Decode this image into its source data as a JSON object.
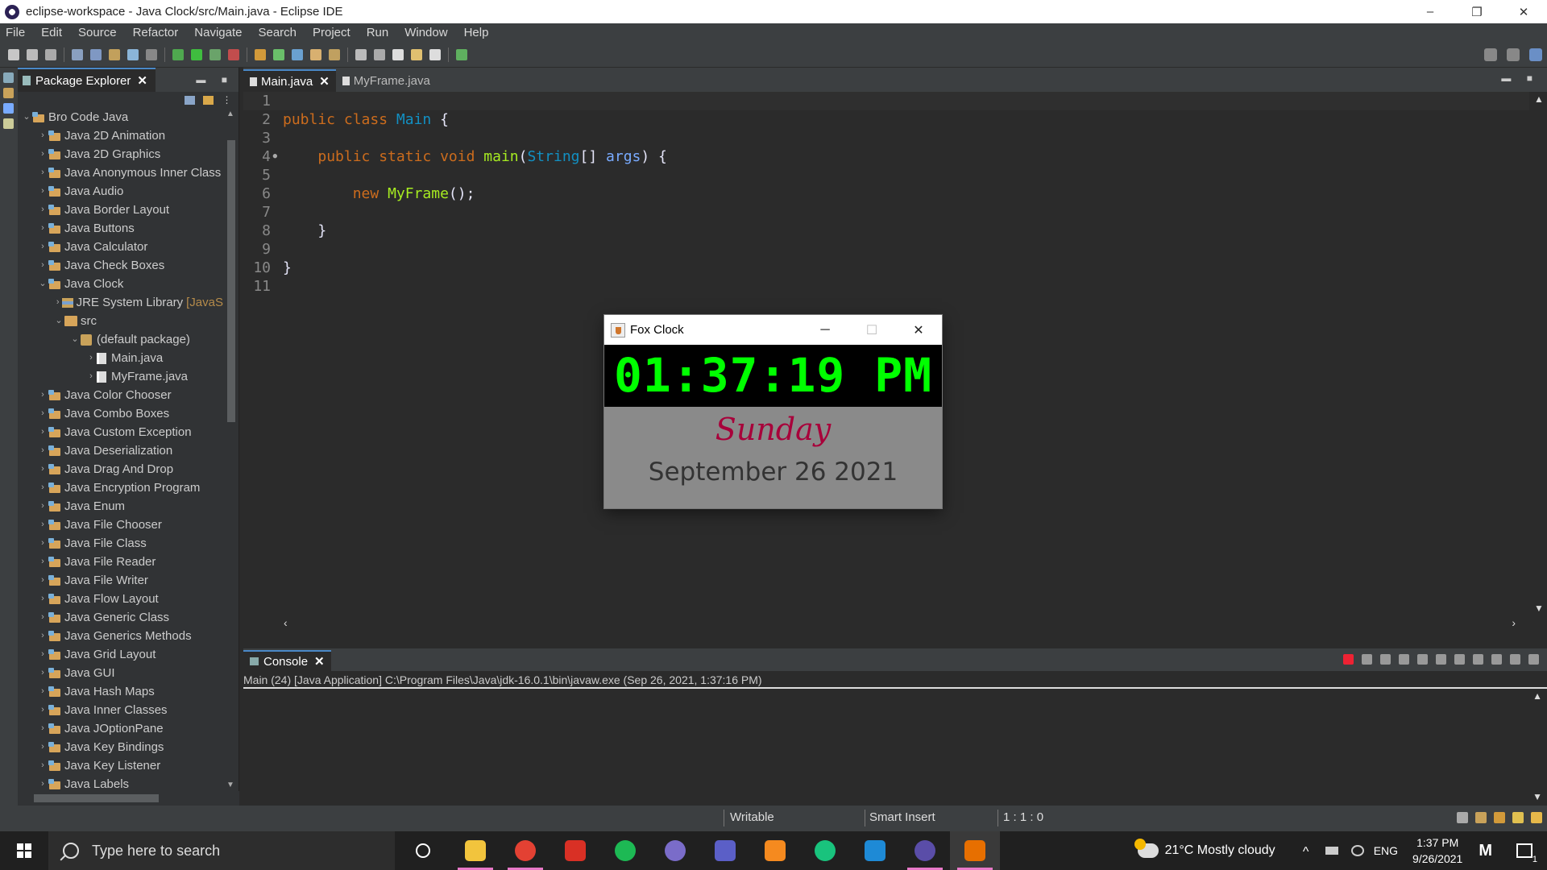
{
  "window": {
    "title": "eclipse-workspace - Java Clock/src/Main.java - Eclipse IDE",
    "minimize": "–",
    "restore": "❐",
    "close": "✕"
  },
  "menu": [
    "File",
    "Edit",
    "Source",
    "Refactor",
    "Navigate",
    "Search",
    "Project",
    "Run",
    "Window",
    "Help"
  ],
  "package_explorer": {
    "tab_label": "Package Explorer",
    "close_label": "✕",
    "view_controls": "▬ ■",
    "tree": [
      {
        "label": "Bro Code Java",
        "depth": 0,
        "expanded": true,
        "icon": "project"
      },
      {
        "label": "Java 2D Animation",
        "depth": 1,
        "expanded": false,
        "icon": "project"
      },
      {
        "label": "Java 2D Graphics",
        "depth": 1,
        "expanded": false,
        "icon": "project"
      },
      {
        "label": "Java Anonymous Inner Class",
        "depth": 1,
        "expanded": false,
        "icon": "project"
      },
      {
        "label": "Java Audio",
        "depth": 1,
        "expanded": false,
        "icon": "project"
      },
      {
        "label": "Java Border Layout",
        "depth": 1,
        "expanded": false,
        "icon": "project"
      },
      {
        "label": "Java Buttons",
        "depth": 1,
        "expanded": false,
        "icon": "project"
      },
      {
        "label": "Java Calculator",
        "depth": 1,
        "expanded": false,
        "icon": "project"
      },
      {
        "label": "Java Check Boxes",
        "depth": 1,
        "expanded": false,
        "icon": "project"
      },
      {
        "label": "Java Clock",
        "depth": 1,
        "expanded": true,
        "icon": "project"
      },
      {
        "label": "JRE System Library",
        "suffix": "[JavaS",
        "depth": 2,
        "expanded": false,
        "icon": "library"
      },
      {
        "label": "src",
        "depth": 2,
        "expanded": true,
        "icon": "source-folder"
      },
      {
        "label": "(default package)",
        "depth": 3,
        "expanded": true,
        "icon": "package"
      },
      {
        "label": "Main.java",
        "depth": 4,
        "expanded": false,
        "icon": "java-file"
      },
      {
        "label": "MyFrame.java",
        "depth": 4,
        "expanded": false,
        "icon": "java-file"
      },
      {
        "label": "Java Color Chooser",
        "depth": 1,
        "expanded": false,
        "icon": "project"
      },
      {
        "label": "Java Combo Boxes",
        "depth": 1,
        "expanded": false,
        "icon": "project"
      },
      {
        "label": "Java Custom Exception",
        "depth": 1,
        "expanded": false,
        "icon": "project"
      },
      {
        "label": "Java Deserialization",
        "depth": 1,
        "expanded": false,
        "icon": "project"
      },
      {
        "label": "Java Drag And Drop",
        "depth": 1,
        "expanded": false,
        "icon": "project"
      },
      {
        "label": "Java Encryption Program",
        "depth": 1,
        "expanded": false,
        "icon": "project"
      },
      {
        "label": "Java Enum",
        "depth": 1,
        "expanded": false,
        "icon": "project"
      },
      {
        "label": "Java File Chooser",
        "depth": 1,
        "expanded": false,
        "icon": "project"
      },
      {
        "label": "Java File Class",
        "depth": 1,
        "expanded": false,
        "icon": "project"
      },
      {
        "label": "Java File Reader",
        "depth": 1,
        "expanded": false,
        "icon": "project"
      },
      {
        "label": "Java File Writer",
        "depth": 1,
        "expanded": false,
        "icon": "project"
      },
      {
        "label": "Java Flow Layout",
        "depth": 1,
        "expanded": false,
        "icon": "project"
      },
      {
        "label": "Java Generic Class",
        "depth": 1,
        "expanded": false,
        "icon": "project"
      },
      {
        "label": "Java Generics Methods",
        "depth": 1,
        "expanded": false,
        "icon": "project"
      },
      {
        "label": "Java Grid Layout",
        "depth": 1,
        "expanded": false,
        "icon": "project"
      },
      {
        "label": "Java GUI",
        "depth": 1,
        "expanded": false,
        "icon": "project"
      },
      {
        "label": "Java Hash Maps",
        "depth": 1,
        "expanded": false,
        "icon": "project"
      },
      {
        "label": "Java Inner Classes",
        "depth": 1,
        "expanded": false,
        "icon": "project"
      },
      {
        "label": "Java JOptionPane",
        "depth": 1,
        "expanded": false,
        "icon": "project"
      },
      {
        "label": "Java Key Bindings",
        "depth": 1,
        "expanded": false,
        "icon": "project"
      },
      {
        "label": "Java Key Listener",
        "depth": 1,
        "expanded": false,
        "icon": "project"
      },
      {
        "label": "Java Labels",
        "depth": 1,
        "expanded": false,
        "icon": "project"
      }
    ]
  },
  "editor": {
    "tabs": [
      {
        "label": "Main.java",
        "active": true,
        "close": "✕"
      },
      {
        "label": "MyFrame.java",
        "active": false
      }
    ],
    "view_controls": "▬ ■",
    "lines": [
      {
        "n": "1",
        "tokens": []
      },
      {
        "n": "2",
        "tokens": [
          [
            "kw",
            "public "
          ],
          [
            "kw",
            "class "
          ],
          [
            "cls",
            "Main"
          ],
          [
            "pl",
            " {"
          ]
        ]
      },
      {
        "n": "3",
        "tokens": []
      },
      {
        "n": "4",
        "mark": true,
        "tokens": [
          [
            "pl",
            "    "
          ],
          [
            "kw",
            "public "
          ],
          [
            "kw",
            "static "
          ],
          [
            "kw",
            "void "
          ],
          [
            "fn",
            "main"
          ],
          [
            "pl",
            "("
          ],
          [
            "cls",
            "String"
          ],
          [
            "pl",
            "[] "
          ],
          [
            "var",
            "args"
          ],
          [
            "pl",
            ") {"
          ]
        ]
      },
      {
        "n": "5",
        "tokens": []
      },
      {
        "n": "6",
        "tokens": [
          [
            "pl",
            "        "
          ],
          [
            "kw",
            "new "
          ],
          [
            "fn",
            "MyFrame"
          ],
          [
            "pl",
            "();"
          ]
        ]
      },
      {
        "n": "7",
        "tokens": []
      },
      {
        "n": "8",
        "tokens": [
          [
            "pl",
            "    }"
          ]
        ]
      },
      {
        "n": "9",
        "tokens": []
      },
      {
        "n": "10",
        "tokens": [
          [
            "pl",
            "}"
          ]
        ]
      },
      {
        "n": "11",
        "tokens": []
      }
    ]
  },
  "fox_clock": {
    "title": "Fox Clock",
    "minimize": "─",
    "maximize": "☐",
    "close": "✕",
    "time": "01:37:19 PM",
    "day": "Sunday",
    "date": "September 26 2021"
  },
  "console": {
    "tab_label": "Console",
    "close_label": "✕",
    "info": "Main (24) [Java Application] C:\\Program Files\\Java\\jdk-16.0.1\\bin\\javaw.exe  (Sep 26, 2021, 1:37:16 PM)"
  },
  "status_bar": {
    "writable": "Writable",
    "insert_mode": "Smart Insert",
    "position": "1 : 1 : 0"
  },
  "taskbar": {
    "search_placeholder": "Type here to search",
    "weather": "21°C  Mostly cloudy",
    "language": "ENG",
    "time": "1:37 PM",
    "date": "9/26/2021",
    "notification_count": "1",
    "apps": [
      {
        "name": "file-explorer-icon",
        "color": "#f2c43d",
        "running": true
      },
      {
        "name": "chrome-icon",
        "color": "#e34133",
        "running": true
      },
      {
        "name": "gmail-icon",
        "color": "#d93025",
        "running": false
      },
      {
        "name": "spotify-icon",
        "color": "#1db954",
        "running": false
      },
      {
        "name": "eclipse-icon",
        "color": "#7a6cc9",
        "running": false
      },
      {
        "name": "teams-icon",
        "color": "#5b5fc7",
        "running": false
      },
      {
        "name": "sublime-icon",
        "color": "#f58a1f",
        "running": false
      },
      {
        "name": "chatgpt-icon",
        "color": "#19c37d",
        "running": false
      },
      {
        "name": "vscode-icon",
        "color": "#1e8ad6",
        "running": false
      },
      {
        "name": "eclipse-running-icon",
        "color": "#5a4da8",
        "running": true
      },
      {
        "name": "java-icon",
        "color": "#e76f00",
        "running": true,
        "active": true
      }
    ]
  }
}
